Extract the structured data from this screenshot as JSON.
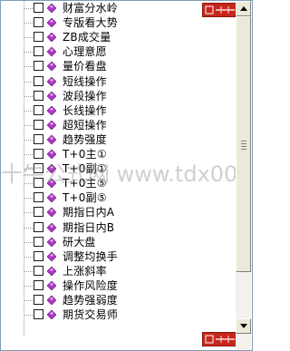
{
  "tree": {
    "items": [
      {
        "label": "财富分水岭"
      },
      {
        "label": "专版看大势"
      },
      {
        "label": "ZB成交量"
      },
      {
        "label": "心理意愿"
      },
      {
        "label": "量价看盘"
      },
      {
        "label": "短线操作"
      },
      {
        "label": "波段操作"
      },
      {
        "label": "长线操作"
      },
      {
        "label": "超短操作"
      },
      {
        "label": "趋势强度"
      },
      {
        "label": "T+0主①"
      },
      {
        "label": "T+0副①"
      },
      {
        "label": "T+0主⑤"
      },
      {
        "label": "T+0副⑤"
      },
      {
        "label": "期指日内A"
      },
      {
        "label": "期指日内B"
      },
      {
        "label": "研大盘"
      },
      {
        "label": "调整均换手"
      },
      {
        "label": "上涨斜率"
      },
      {
        "label": "操作风险度"
      },
      {
        "label": "趋势强弱度"
      },
      {
        "label": "期货交易师"
      }
    ]
  },
  "watermark": {
    "text": "十牛公式网      www.tdx001.com"
  },
  "colors": {
    "leaf": "#b236c9",
    "logo": "#c8261c",
    "checkbox_border": "#1c1c1c"
  },
  "icons": {
    "leaf": "diamond-leaf-icon",
    "logo": "brand-logo-icon"
  }
}
